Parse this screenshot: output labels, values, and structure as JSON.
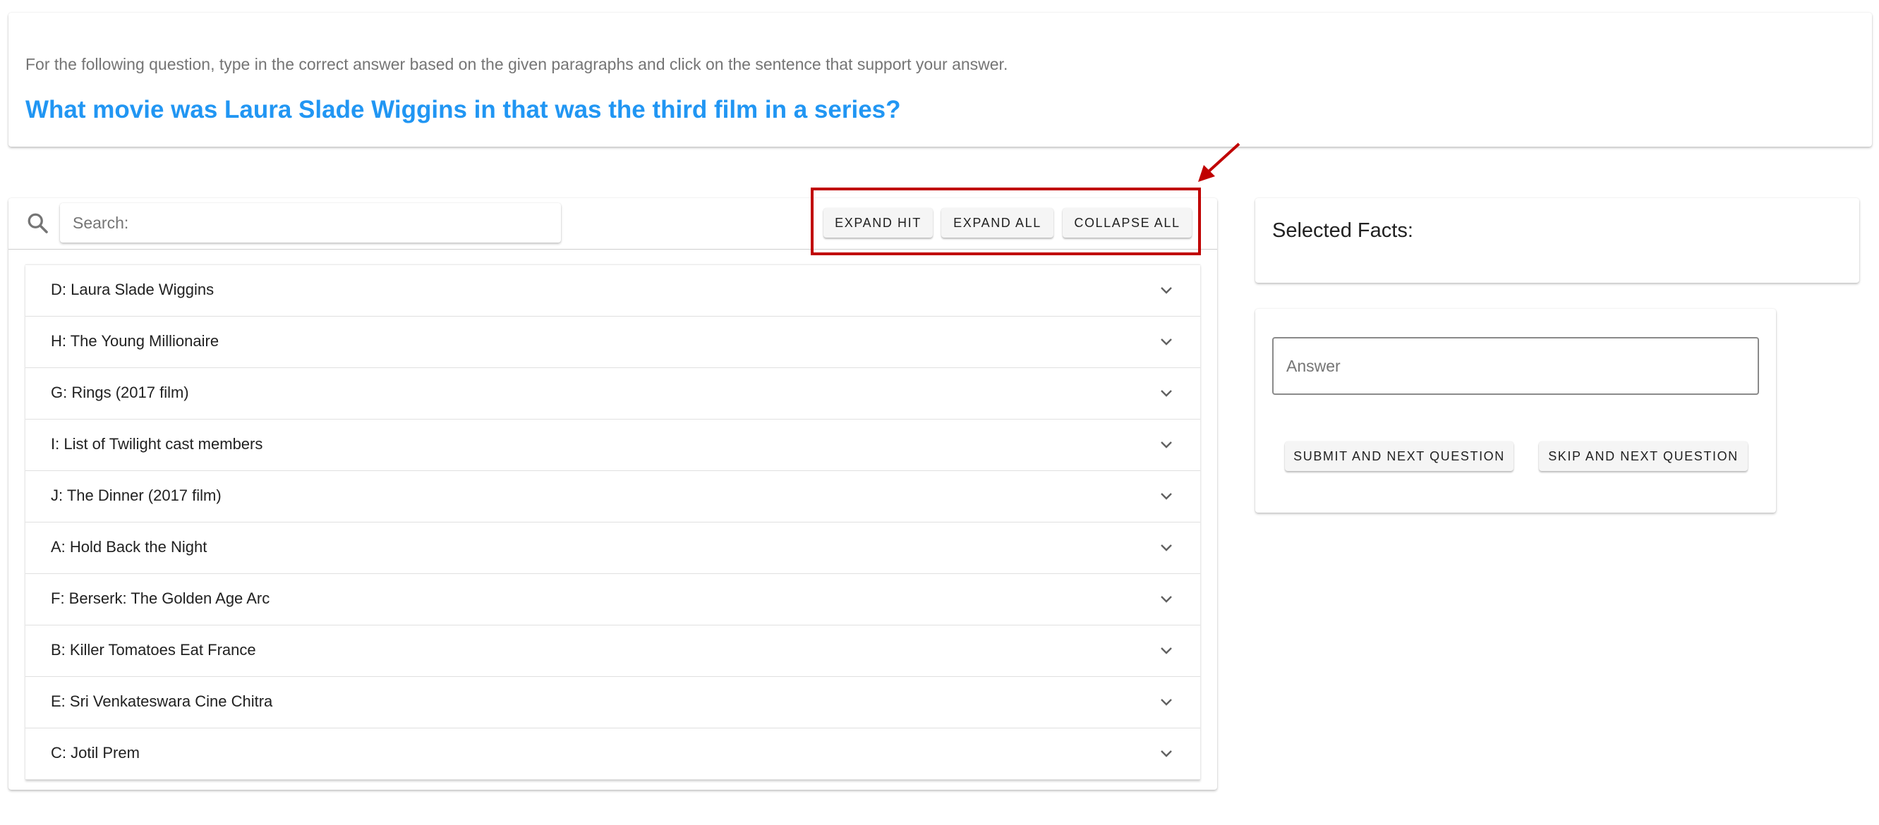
{
  "question_card": {
    "instructions": "For the following question, type in the correct answer based on the given paragraphs and click on the sentence that support your answer.",
    "question": "What movie was Laura Slade Wiggins in that was the third film in a series?"
  },
  "toolbar": {
    "search_placeholder": "Search:",
    "search_value": "",
    "expand_hit_label": "EXPAND HIT",
    "expand_all_label": "EXPAND ALL",
    "collapse_all_label": "COLLAPSE ALL"
  },
  "documents": [
    {
      "label": "D: Laura Slade Wiggins"
    },
    {
      "label": "H: The Young Millionaire"
    },
    {
      "label": "G: Rings (2017 film)"
    },
    {
      "label": "I: List of Twilight cast members"
    },
    {
      "label": "J: The Dinner (2017 film)"
    },
    {
      "label": "A: Hold Back the Night"
    },
    {
      "label": "F: Berserk: The Golden Age Arc"
    },
    {
      "label": "B: Killer Tomatoes Eat France"
    },
    {
      "label": "E: Sri Venkateswara Cine Chitra"
    },
    {
      "label": "C: Jotil Prem"
    }
  ],
  "facts_panel": {
    "title": "Selected Facts:"
  },
  "answer_panel": {
    "answer_placeholder": "Answer",
    "answer_value": "",
    "submit_label": "SUBMIT AND NEXT QUESTION",
    "skip_label": "SKIP AND NEXT QUESTION"
  },
  "icons": {
    "search": "search-icon",
    "chevron": "chevron-down-icon",
    "annotation_arrow": "arrow-icon"
  },
  "colors": {
    "question_blue": "#2196f3",
    "highlight_red": "#c00000"
  }
}
